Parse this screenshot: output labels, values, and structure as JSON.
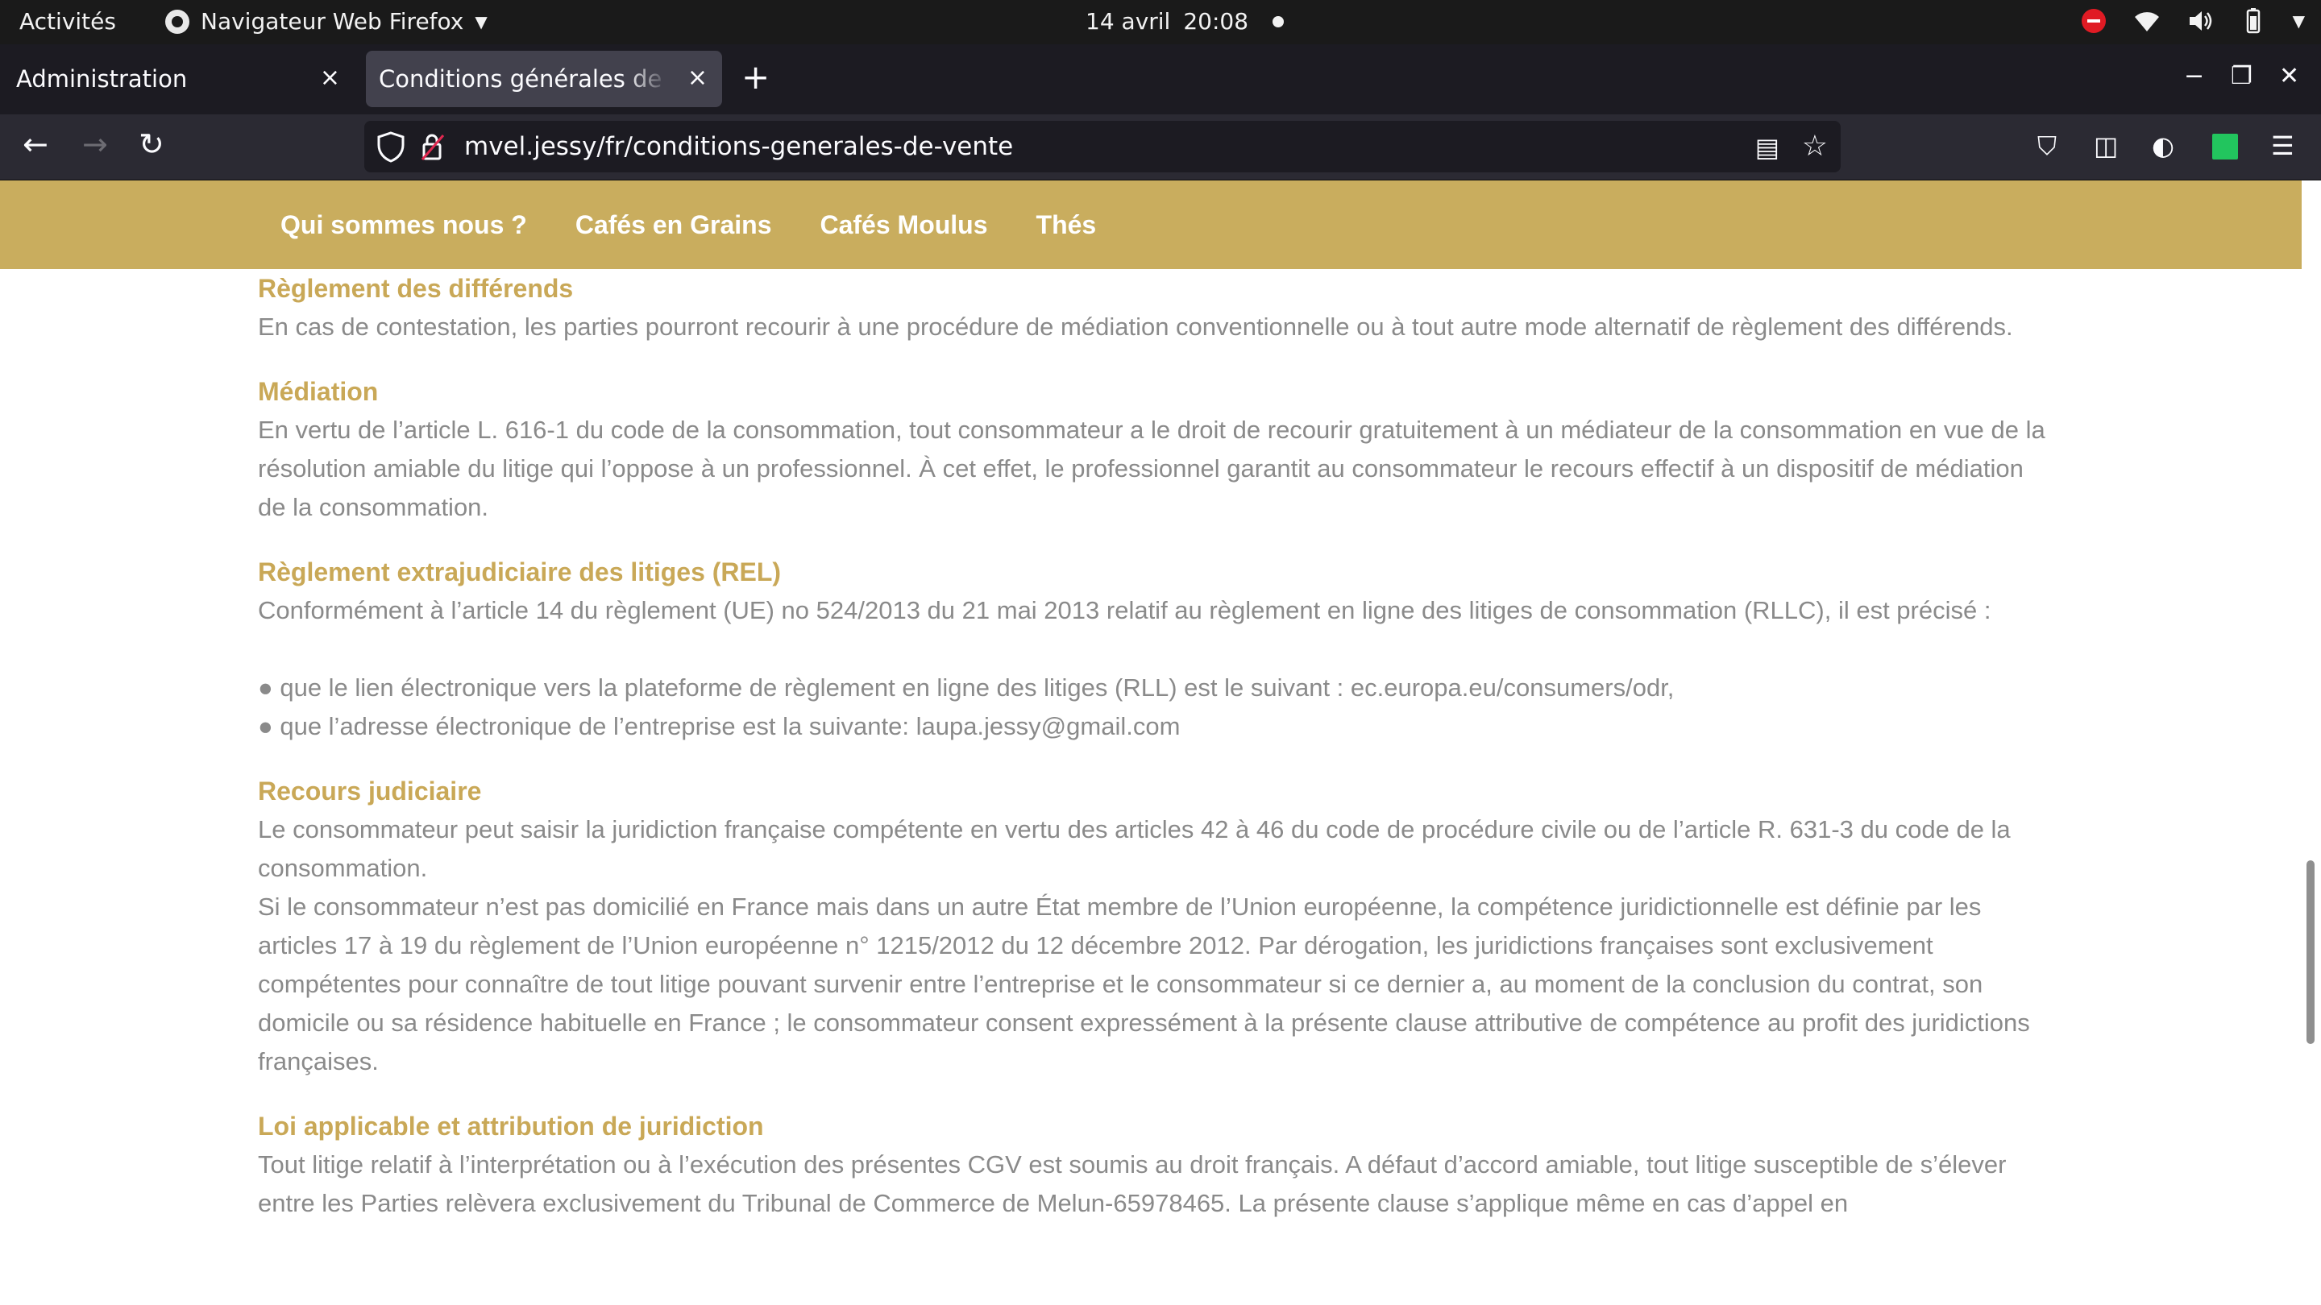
{
  "system_bar": {
    "activities": "Activités",
    "app_name": "Navigateur Web Firefox",
    "date": "14 avril",
    "time": "20:08"
  },
  "tabs": [
    {
      "title": "Administration",
      "active": false
    },
    {
      "title": "Conditions générales de vente",
      "active": true
    }
  ],
  "toolbar": {
    "url": "mvel.jessy/fr/conditions-generales-de-vente"
  },
  "site_nav": {
    "items": [
      "Qui sommes nous ?",
      "Cafés en Grains",
      "Cafés Moulus",
      "Thés"
    ]
  },
  "colors": {
    "nav_background": "#c9ad5e",
    "heading": "#c9a857",
    "body_text": "#8a8a8a"
  },
  "sections": {
    "differends": {
      "title": "Règlement des différends",
      "text": "En cas de contestation, les parties pourront recourir à une procédure de médiation conventionnelle ou à tout autre mode alternatif de règlement des différends."
    },
    "mediation": {
      "title": "Médiation",
      "text": "En vertu de l’article L. 616-1 du code de la consommation, tout consommateur a le droit de recourir gratuitement à un médiateur de la consommation en vue de la résolution amiable du litige qui l’oppose à un professionnel. À cet effet, le professionnel garantit au consommateur le recours effectif à un dispositif de médiation de la consommation."
    },
    "rel": {
      "title": "Règlement extrajudiciaire des litiges (REL)",
      "text": "Conformément à l’article 14 du règlement (UE) no 524/2013 du 21 mai 2013 relatif au règlement en ligne des litiges de consommation (RLLC), il est précisé :",
      "bullet_1": "● que le lien électronique vers la plateforme de règlement en ligne des litiges (RLL) est le suivant : ec.europa.eu/consumers/odr,",
      "bullet_2": "● que l’adresse électronique de l’entreprise est la suivante: laupa.jessy@gmail.com"
    },
    "recours": {
      "title": "Recours judiciaire",
      "text_1": "Le consommateur peut saisir la juridiction française compétente en vertu des articles 42 à 46 du code de procédure civile ou de l’article R. 631-3 du code de la consommation.",
      "text_2": "Si le consommateur n’est pas domicilié en France mais dans un autre État membre de l’Union européenne, la compétence juridictionnelle est définie par les articles 17 à 19 du règlement de l’Union européenne n° 1215/2012 du 12 décembre 2012. Par dérogation, les juridictions françaises sont exclusivement compétentes pour connaître de tout litige pouvant survenir entre l’entreprise et le consommateur si ce dernier a, au moment de la conclusion du contrat, son domicile ou sa résidence habituelle en France ; le consommateur consent expressément à la présente clause attributive de compétence au profit des juridictions françaises."
    },
    "loi": {
      "title": "Loi applicable et attribution de juridiction",
      "text": "Tout litige relatif à l’interprétation ou à l’exécution des présentes CGV est soumis au droit français. A défaut d’accord amiable, tout litige susceptible de s’élever entre les Parties relèvera exclusivement du Tribunal de Commerce de Melun-65978465. La présente clause s’applique même en cas d’appel en"
    }
  }
}
